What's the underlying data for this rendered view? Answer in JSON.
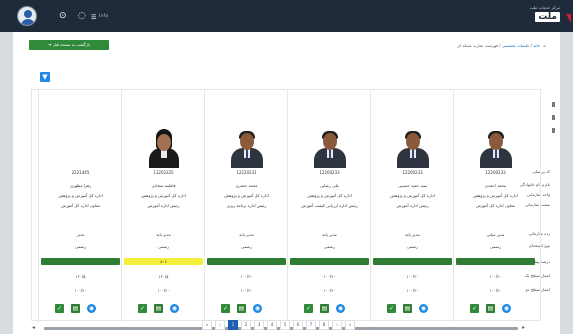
{
  "topbar": {
    "text": "Info",
    "brand_sub": "مرکز خدمات ملت",
    "brand_logo": "ملت"
  },
  "breadcrumb": {
    "item1": "خانه",
    "item2": "جلسات تخصصی",
    "item3": "فهرست تجارب شبکه ای"
  },
  "back_button": "بازگشت به صفحه قبل",
  "row_labels": [
    "کد پرسنلی",
    "نام و نام خانوادگی",
    "واحد سازمانی",
    "سمت سازمانی",
    "رده سازمانی",
    "نوع استخدام",
    "درصد پیشرفت",
    "امتیاز سطح یک",
    "امتیاز سطح دو"
  ],
  "people": [
    {
      "id": "2221445",
      "name": "زهرا مظهری",
      "unit": "اداره کل آموزش و پژوهش",
      "position": "معاون اداره کل آموزش",
      "rank": "مدیر",
      "type": "رسمی",
      "progress": 100,
      "progress_text": "",
      "bar_color": "#2e7d32",
      "score1": "۱۲۰/۵",
      "score2": "۱۰۰/۲۰",
      "gender": "female"
    },
    {
      "id": "11202325",
      "name": "فاطمه سجادی",
      "unit": "اداره کل آموزش و پژوهش",
      "position": "رئیس اداره آموزش",
      "rank": "مدیر پایه",
      "type": "رسمی",
      "progress": 80,
      "progress_text": "۸۰٪",
      "bar_color": "#f5ef3b",
      "score1": "۱۲۰/۵",
      "score2": "۱۰۰/۲۰",
      "gender": "female"
    },
    {
      "id": "12220231",
      "name": "محمد جعفری",
      "unit": "اداره کل آموزش و پژوهش",
      "position": "رئیس اداره برنامه ریزی",
      "rank": "مدیر پایه",
      "type": "رسمی",
      "progress": 100,
      "progress_text": "",
      "bar_color": "#2e7d32",
      "score1": "۱۰۰/۳۰",
      "score2": "۱۰۰/۲۰",
      "gender": "male"
    },
    {
      "id": "12200233",
      "name": "علی رضایی",
      "unit": "اداره کل آموزش و پژوهش",
      "position": "رئیس اداره ارزیابی کیفیت آموزش",
      "rank": "مدیر پایه",
      "type": "رسمی",
      "progress": 100,
      "progress_text": "",
      "bar_color": "#2e7d32",
      "score1": "۱۰۰/۲۰",
      "score2": "۱۰۰/۲۰",
      "gender": "male"
    },
    {
      "id": "12200233",
      "name": "سید حمید حسینی",
      "unit": "اداره کل آموزش و پژوهش",
      "position": "رئیس اداره آموزش",
      "rank": "مدیر پایه",
      "type": "رسمی",
      "progress": 100,
      "progress_text": "",
      "bar_color": "#2e7d32",
      "score1": "۱۰۰/۲۰",
      "score2": "۱۰۰/۲۰",
      "gender": "male"
    },
    {
      "id": "12200233",
      "name": "محمد احمدی",
      "unit": "اداره کل آموزش و پژوهش",
      "position": "معاون اداره کل آموزش",
      "rank": "مدیر میانی",
      "type": "رسمی",
      "progress": 100,
      "progress_text": "",
      "bar_color": "#2e7d32",
      "score1": "۱۰۰/۲۰",
      "score2": "۱۰۰/۲۰",
      "gender": "male"
    }
  ],
  "pagination": {
    "prev": "«",
    "first_prev": "‹",
    "pages": [
      "1",
      "2",
      "3",
      "4",
      "5",
      "6",
      "7",
      "8",
      "9",
      "10"
    ],
    "next": "›",
    "last": "»",
    "active": "1"
  },
  "colors": {
    "accent": "#1e5fb0",
    "topbar": "#1f2a3a",
    "success": "#2e7d32",
    "warning": "#f5ef3b",
    "back_button": "#2f8a3a"
  },
  "icons": {
    "filter": "filter-icon",
    "check": "check-icon",
    "document": "document-icon",
    "view": "eye-icon"
  }
}
